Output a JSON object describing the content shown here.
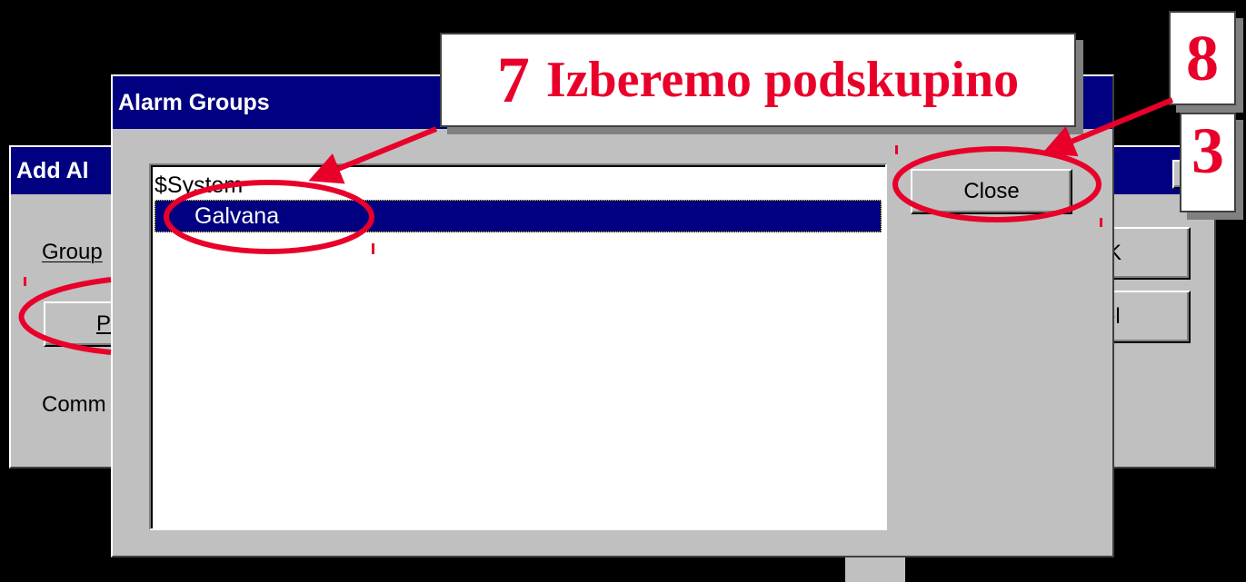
{
  "add_dialog": {
    "title": "Add Al",
    "group_label": "Group",
    "pick_button": "P",
    "comment_label": "Comm",
    "ok_button": "K",
    "cancel_button": "cel",
    "close_glyph": "✕"
  },
  "alarm_groups": {
    "title": "Alarm Groups",
    "items": [
      "$System",
      "Galvana"
    ],
    "selected_index": 1,
    "close_button": "Close"
  },
  "annotations": {
    "step7": {
      "number": "7",
      "text": "Izberemo podskupino"
    },
    "step8": {
      "number": "8"
    },
    "step9": {
      "number": "3"
    }
  },
  "colors": {
    "highlight": "#e8002a",
    "titlebar": "#000080",
    "window": "#c0c0c0"
  }
}
